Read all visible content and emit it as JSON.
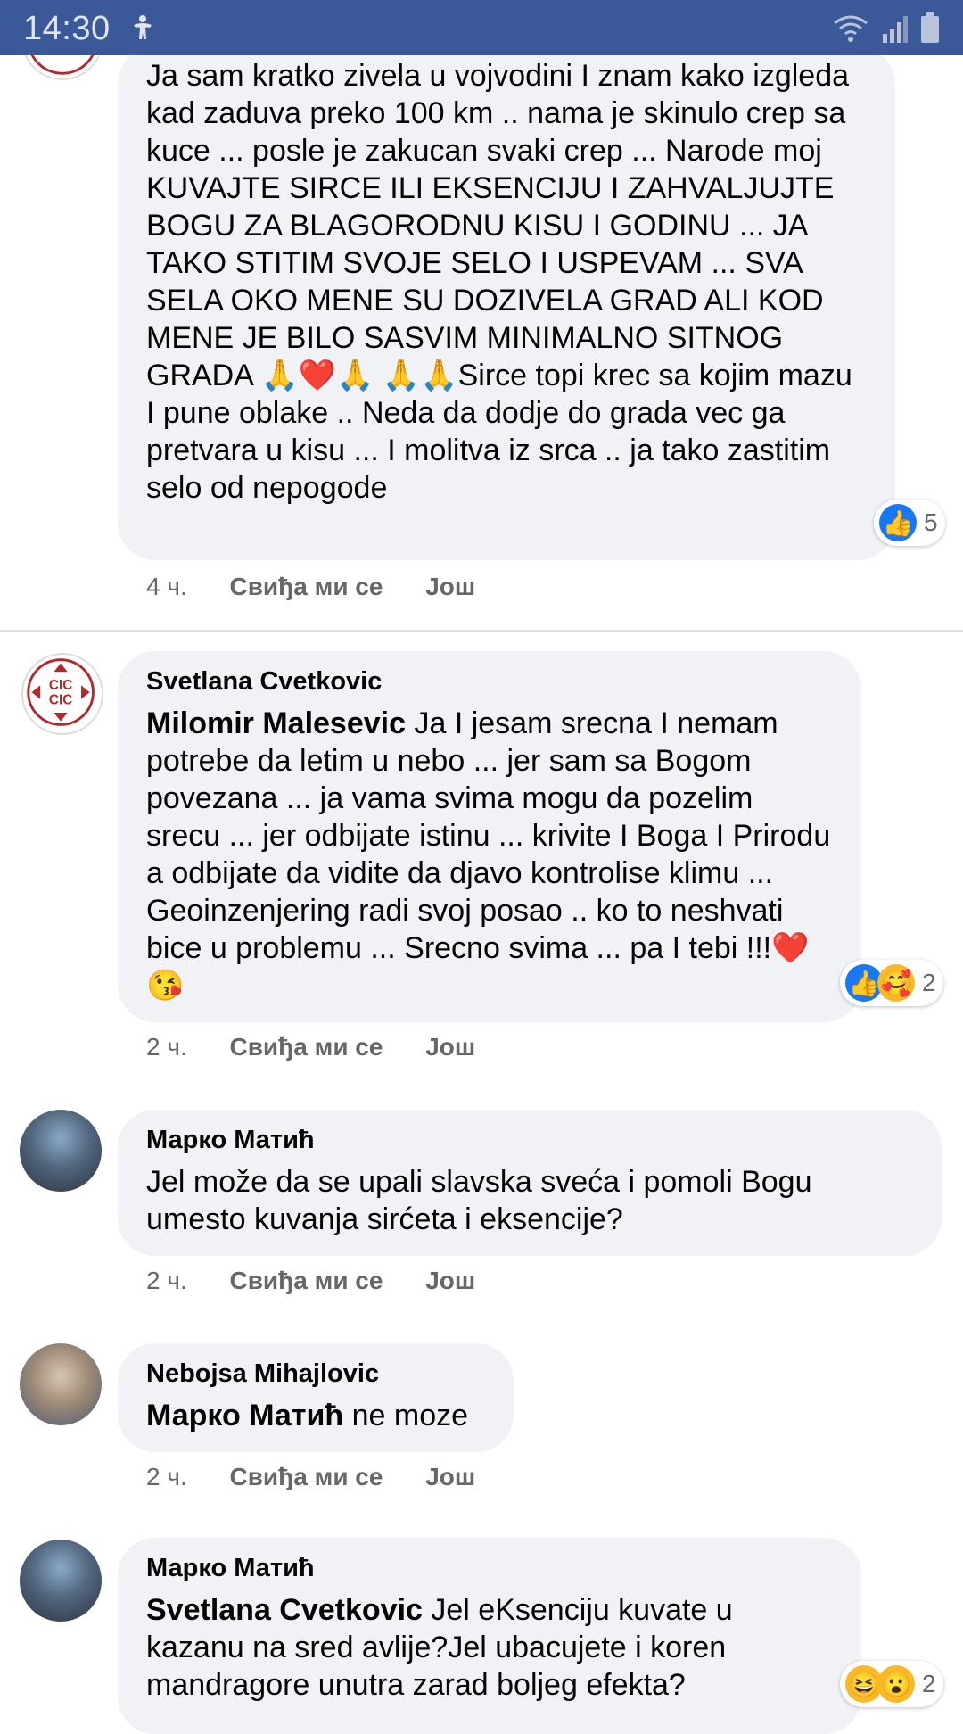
{
  "status": {
    "time": "14:30"
  },
  "comments": [
    {
      "author": "",
      "mention": "",
      "text": "Ja sam kratko zivela u vojvodini I znam kako izgleda kad zaduva preko 100 km .. nama je skinulo crep sa kuce ... posle je zakucan svaki crep ... Narode moj KUVAJTE SIRCE ILI EKSENCIJU I ZAHVALJUJTE BOGU ZA BLAGORODNU KISU I GODINU ... JA TAKO STITIM SVOJE SELO I USPEVAM ... SVA SELA OKO MENE SU DOZIVELA GRAD ALI KOD MENE JE BILO SASVIM MINIMALNO SITNOG GRADA 🙏❤️🙏 🙏🙏Sirce topi krec sa kojim mazu I pune oblake .. Neda da dodje do grada vec ga pretvara u kisu ... I molitva iz srca .. ja tako zastitim selo od nepogode",
      "time": "4 ч.",
      "like": "Свиђа ми се",
      "more": "Још",
      "reaction_count": "5",
      "reaction_icons": [
        "like-icon"
      ]
    },
    {
      "author": "Svetlana Cvetkovic",
      "mention": "Milomir Malesevic",
      "text": "Ja I jesam srecna I nemam potrebe da letim u nebo ... jer sam sa Bogom povezana ... ja vama svima mogu da pozelim srecu ... jer odbijate istinu ... krivite I Boga I Prirodu a odbijate da vidite da djavo kontrolise klimu ... Geoinzenjering radi svoj posao .. ko to neshvati bice u problemu ... Srecno svima ... pa I tebi !!!❤️😘",
      "time": "2 ч.",
      "like": "Свиђа ми се",
      "more": "Још",
      "reaction_count": "2",
      "reaction_icons": [
        "like-icon",
        "care-icon"
      ]
    },
    {
      "author": "Марко Матић",
      "mention": "",
      "text": "Jel može da se upali slavska sveća i pomoli Bogu umesto kuvanja sirćeta i eksencije?",
      "time": "2 ч.",
      "like": "Свиђа ми се",
      "more": "Још"
    },
    {
      "author": "Nebojsa Mihajlovic",
      "mention": "Марко Матић",
      "text": "ne moze",
      "time": "2 ч.",
      "like": "Свиђа ми се",
      "more": "Још"
    },
    {
      "author": "Марко Матић",
      "mention": "Svetlana Cvetkovic",
      "text": "Jel eKsenciju kuvate u kazanu na sred avlije?Jel ubacujete i koren mandragore unutra zarad boljeg efekta?",
      "reaction_count": "2",
      "reaction_icons": [
        "haha-icon",
        "wow-icon"
      ]
    }
  ]
}
